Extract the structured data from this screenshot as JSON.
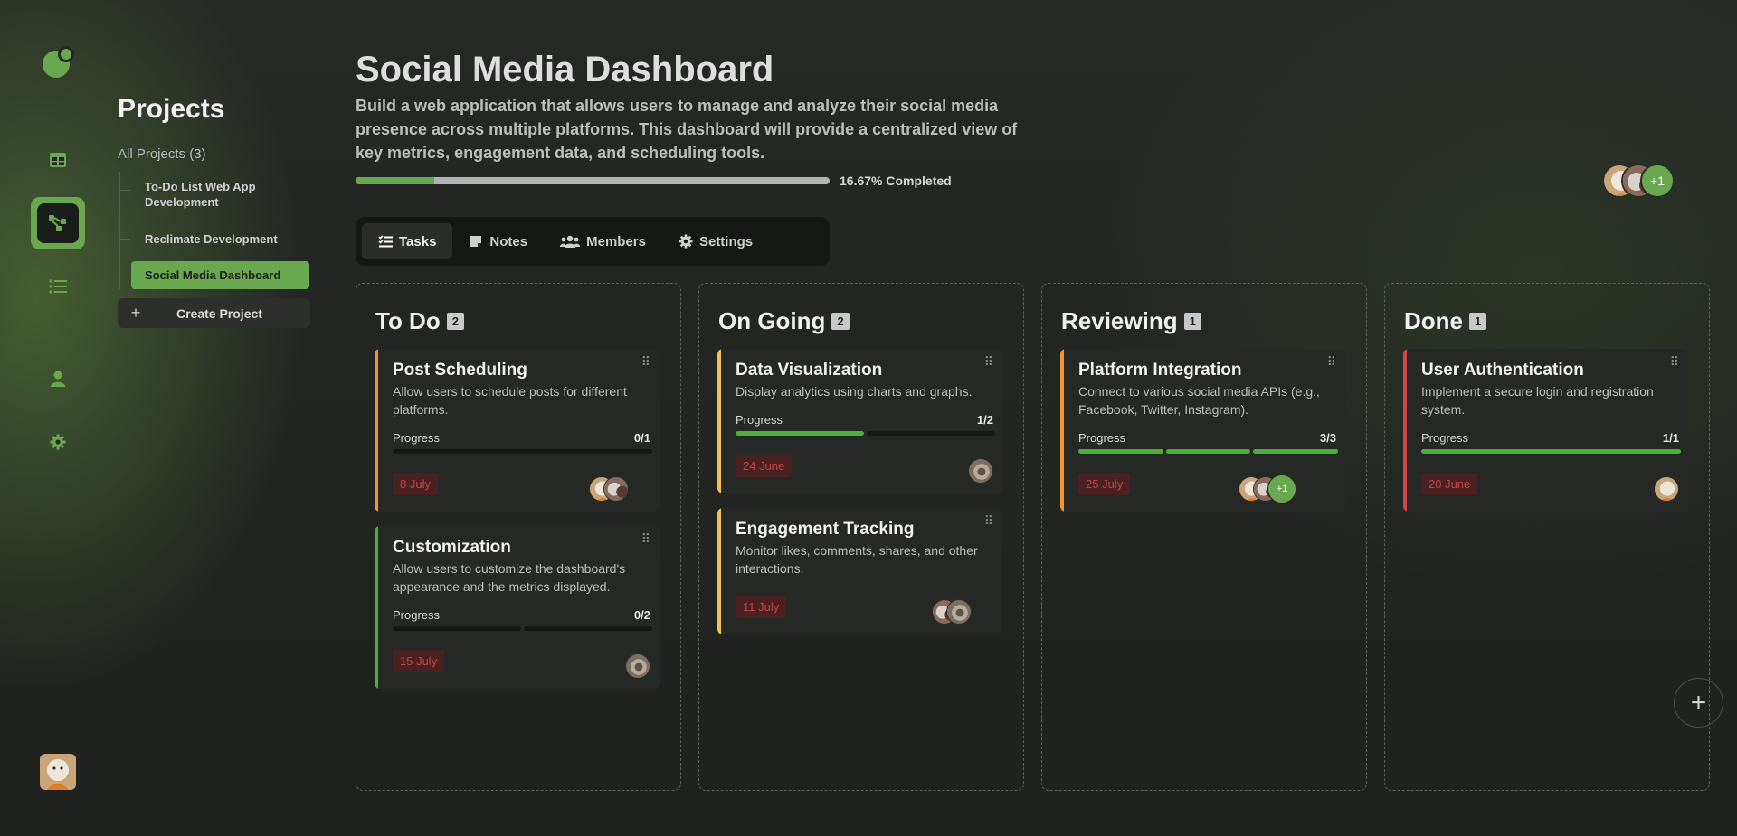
{
  "sidebar": {
    "title": "Projects",
    "all_projects": "All Projects (3)",
    "items": [
      {
        "label": "To-Do List Web App Development"
      },
      {
        "label": "Reclimate Development"
      },
      {
        "label": "Social Media Dashboard"
      }
    ],
    "create_label": "Create Project"
  },
  "header": {
    "title": "Social Media Dashboard",
    "description": "Build a web application that allows users to manage and analyze their social media presence across multiple platforms. This dashboard will provide a centralized view of key metrics, engagement data, and scheduling tools.",
    "progress": 0.1667,
    "progress_text": "16.67% Completed",
    "members_extra": "+1"
  },
  "tabs": [
    {
      "label": "Tasks",
      "icon": "tasks-icon"
    },
    {
      "label": "Notes",
      "icon": "note-icon"
    },
    {
      "label": "Members",
      "icon": "members-icon"
    },
    {
      "label": "Settings",
      "icon": "gear-icon"
    }
  ],
  "columns": [
    {
      "title": "To Do",
      "count": "2",
      "cards": [
        {
          "title": "Post Scheduling",
          "desc": "Allow users to schedule posts for different platforms.",
          "progress_label": "Progress",
          "progress_value": "0/1",
          "done": 0,
          "total": 1,
          "date": "8 July",
          "accent": "#f0962e"
        },
        {
          "title": "Customization",
          "desc": "Allow users to customize the dashboard's appearance and the metrics displayed.",
          "progress_label": "Progress",
          "progress_value": "0/2",
          "done": 0,
          "total": 2,
          "date": "15 July",
          "accent": "#4caf3a"
        }
      ]
    },
    {
      "title": "On Going",
      "count": "2",
      "cards": [
        {
          "title": "Data Visualization",
          "desc": "Display analytics using charts and graphs.",
          "progress_label": "Progress",
          "progress_value": "1/2",
          "done": 1,
          "total": 2,
          "date": "24 June",
          "accent": "#f2c14e"
        },
        {
          "title": "Engagement Tracking",
          "desc": "Monitor likes, comments, shares, and other interactions.",
          "date": "11 July",
          "accent": "#f2c14e"
        }
      ]
    },
    {
      "title": "Reviewing",
      "count": "1",
      "cards": [
        {
          "title": "Platform Integration",
          "desc": "Connect to various social media APIs (e.g., Facebook, Twitter, Instagram).",
          "progress_label": "Progress",
          "progress_value": "3/3",
          "done": 3,
          "total": 3,
          "date": "25 July",
          "accent": "#f0962e",
          "extra": "+1"
        }
      ]
    },
    {
      "title": "Done",
      "count": "1",
      "cards": [
        {
          "title": "User Authentication",
          "desc": "Implement a secure login and registration system.",
          "progress_label": "Progress",
          "progress_value": "1/1",
          "done": 1,
          "total": 1,
          "date": "20 June",
          "accent": "#d64545"
        }
      ]
    }
  ],
  "colors": {
    "accent": "#6aa84f",
    "date_bg": "#4a2020",
    "date_text": "#c24545"
  }
}
